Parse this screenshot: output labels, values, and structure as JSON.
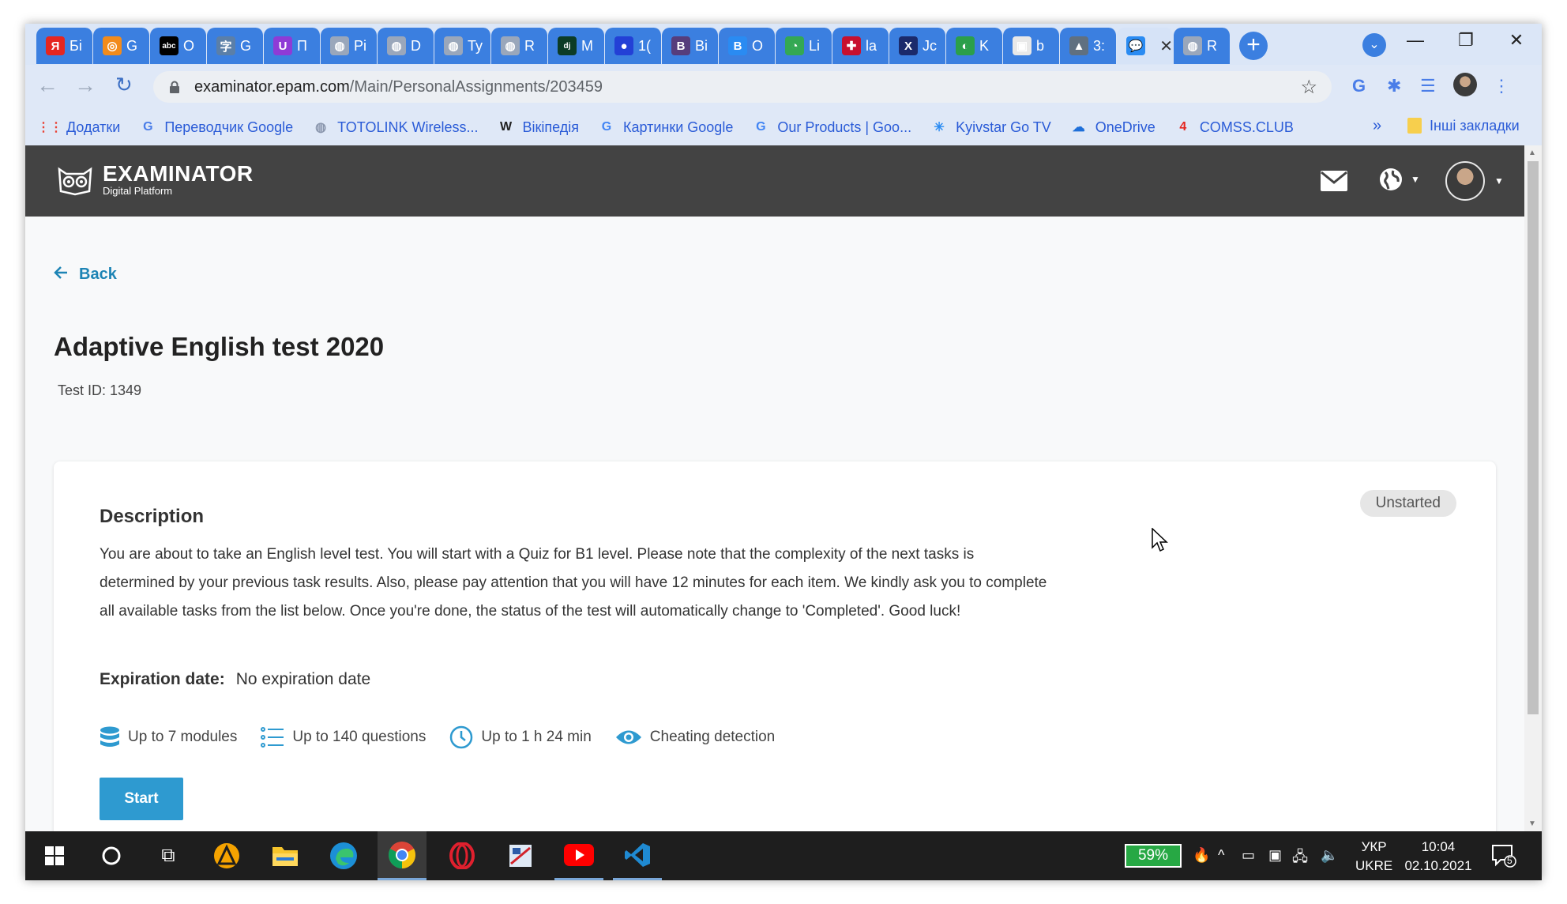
{
  "browser": {
    "tabs": [
      {
        "title": "Бі",
        "icon": "yandex-icon",
        "color": "#e52620",
        "glyph": "Я"
      },
      {
        "title": "G",
        "icon": "orange-ring-icon",
        "color": "#f28b1c",
        "glyph": "◎"
      },
      {
        "title": "O",
        "icon": "abc-icon",
        "color": "#000000",
        "glyph": "abc"
      },
      {
        "title": "G",
        "icon": "translate-icon",
        "color": "#5b7fa8",
        "glyph": "字"
      },
      {
        "title": "П",
        "icon": "purple-u-icon",
        "color": "#8e3bd6",
        "glyph": "U"
      },
      {
        "title": "Pi",
        "icon": "globe-icon",
        "color": "#9aa7bb",
        "glyph": "◍"
      },
      {
        "title": "D",
        "icon": "globe-icon",
        "color": "#9aa7bb",
        "glyph": "◍"
      },
      {
        "title": "Ty",
        "icon": "globe-icon",
        "color": "#9aa7bb",
        "glyph": "◍"
      },
      {
        "title": "R",
        "icon": "globe-icon",
        "color": "#9aa7bb",
        "glyph": "◍"
      },
      {
        "title": "M",
        "icon": "django-icon",
        "color": "#0c3c26",
        "glyph": "dj"
      },
      {
        "title": "1(",
        "icon": "blue-dot-icon",
        "color": "#2340d6",
        "glyph": "●"
      },
      {
        "title": "Bi",
        "icon": "bootstrap-icon",
        "color": "#563d7c",
        "glyph": "B"
      },
      {
        "title": "O",
        "icon": "b-blue-icon",
        "color": "#2a8bf2",
        "glyph": "B"
      },
      {
        "title": "Li",
        "icon": "clock-icon",
        "color": "#34a853",
        "glyph": "◔"
      },
      {
        "title": "la",
        "icon": "uk-flag-icon",
        "color": "#c8102e",
        "glyph": "✚"
      },
      {
        "title": "Jc",
        "icon": "x-icon",
        "color": "#1b2a6b",
        "glyph": "X"
      },
      {
        "title": "K",
        "icon": "kyivstar-icon",
        "color": "#2b9f4a",
        "glyph": "◐"
      },
      {
        "title": "b",
        "icon": "cube-icon",
        "color": "#e8e8e8",
        "glyph": "▣"
      },
      {
        "title": "3:",
        "icon": "grad-cap-icon",
        "color": "#607080",
        "glyph": "▲"
      },
      {
        "title": "",
        "icon": "chat-bubble-icon",
        "color": "#2a8bf2",
        "glyph": "💬",
        "active": true
      },
      {
        "title": "R",
        "icon": "globe-icon",
        "color": "#9aa7bb",
        "glyph": "◍"
      }
    ],
    "new_tab": "+",
    "url_domain": "examinator.epam.com",
    "url_path": "/Main/PersonalAssignments/203459",
    "bookmarks": [
      {
        "label": "Додатки",
        "icon": "apps-grid-icon",
        "glyph": "⋮⋮",
        "color": "#e94235"
      },
      {
        "label": "Переводчик Google",
        "icon": "google-translate-icon",
        "glyph": "G",
        "color": "#4a7de8"
      },
      {
        "label": "TOTOLINK Wireless...",
        "icon": "globe-icon",
        "glyph": "◍",
        "color": "#8a96ad"
      },
      {
        "label": "Вікіпедія",
        "icon": "wikipedia-icon",
        "glyph": "W",
        "color": "#222222"
      },
      {
        "label": "Картинки Google",
        "icon": "google-icon",
        "glyph": "G",
        "color": "#4285f4"
      },
      {
        "label": "Our Products | Goo...",
        "icon": "google-icon",
        "glyph": "G",
        "color": "#4285f4"
      },
      {
        "label": "Kyivstar Go TV",
        "icon": "kyivstar-star-icon",
        "glyph": "✳",
        "color": "#2a8bf2"
      },
      {
        "label": "OneDrive",
        "icon": "cloud-icon",
        "glyph": "☁",
        "color": "#1e6fd9"
      },
      {
        "label": "COMSS.CLUB",
        "icon": "comss-icon",
        "glyph": "4",
        "color": "#e52620"
      }
    ],
    "bookmarks_more": "»",
    "other_bookmarks": "Інші закладки"
  },
  "app": {
    "logo_name": "EXAMINATOR",
    "logo_sub": "Digital Platform",
    "back_label": "Back",
    "title": "Adaptive English test 2020",
    "test_id": "Test ID: 1349",
    "status": "Unstarted",
    "description_title": "Description",
    "description": "You are about to take an English level test. You will start with a Quiz for B1 level. Please note that the complexity of the next tasks is determined by your previous task results. Also, please pay attention that you will have 12 minutes for each item. We kindly ask you to complete all available tasks from the list below. Once you're done, the status of the test will automatically change to 'Completed'. Good luck!",
    "expiration_label": "Expiration date:",
    "expiration_value": "No expiration date",
    "features": {
      "modules": "Up to 7 modules",
      "questions": "Up to 140 questions",
      "duration": "Up to 1 h 24 min",
      "cheating": "Cheating detection"
    },
    "start_label": "Start"
  },
  "taskbar": {
    "battery": "59%",
    "lang_top": "УКР",
    "lang_bottom": "UKRE",
    "time": "10:04",
    "date": "02.10.2021",
    "notifications": "5"
  },
  "colors": {
    "accent": "#2e9ad0",
    "link": "#1d84b5",
    "header_bg": "#434343",
    "tab_blue": "#3b7fe0"
  }
}
